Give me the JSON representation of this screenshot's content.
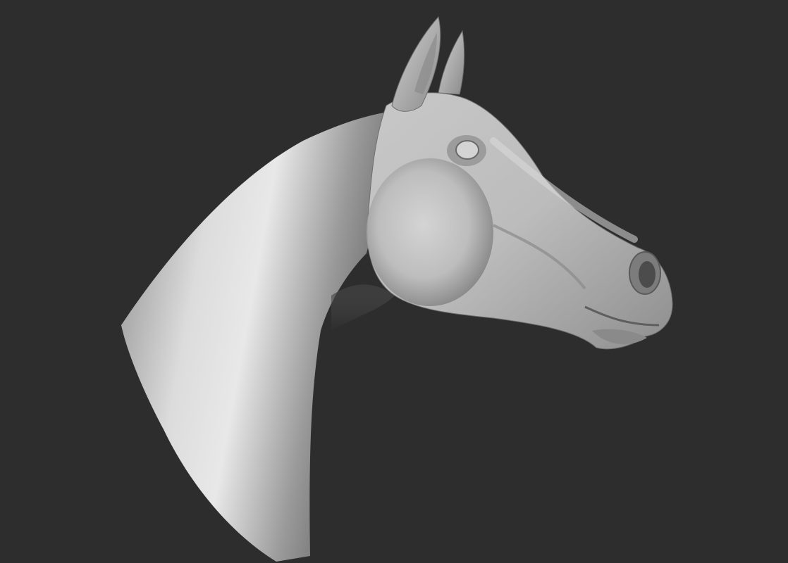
{
  "scene": {
    "background_color": "#2d2d2d",
    "subject": "horse-head-sculpt",
    "material": "matte-grey-clay",
    "material_light_color": "#e6e6e6",
    "material_mid_color": "#a9a9a9",
    "material_dark_color": "#4e4e4e"
  }
}
